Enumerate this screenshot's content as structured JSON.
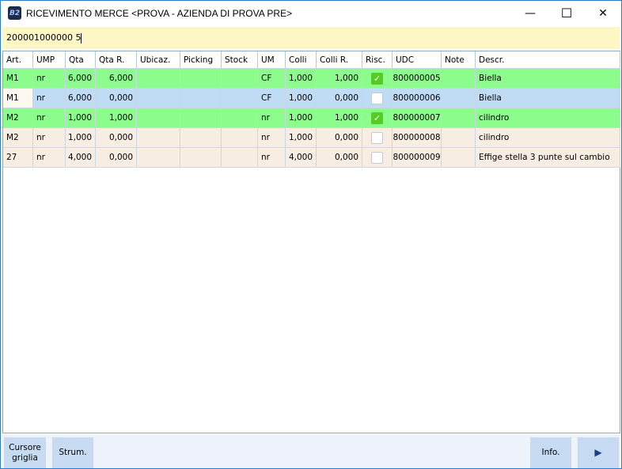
{
  "window": {
    "title": "RICEVIMENTO MERCE <PROVA - AZIENDA DI PROVA PRE>",
    "icon_text": "B2",
    "minimize": "—",
    "maximize": "☐",
    "close": "✕"
  },
  "barcode_input": {
    "value": "200001000000 5"
  },
  "colors": {
    "green": "#8cfc8c",
    "blue": "#c0dcf5",
    "beige": "#f7ede3"
  },
  "columns": [
    "Art.",
    "UMP",
    "Qta",
    "Qta R.",
    "Ubicaz.",
    "Picking",
    "Stock",
    "UM",
    "Colli",
    "Colli R.",
    "Risc.",
    "UDC",
    "Note",
    "Descr."
  ],
  "rows": [
    {
      "art": "M1",
      "ump": "nr",
      "qta": "6,000",
      "qtar": "6,000",
      "ubicaz": "",
      "picking": "",
      "stock": "",
      "um": "CF",
      "colli": "1,000",
      "collir": "1,000",
      "risc": true,
      "udc": "800000005",
      "note": "",
      "descr": "Biella",
      "color": "green"
    },
    {
      "art": "M1",
      "ump": "nr",
      "qta": "6,000",
      "qtar": "0,000",
      "ubicaz": "",
      "picking": "",
      "stock": "",
      "um": "CF",
      "colli": "1,000",
      "collir": "0,000",
      "risc": false,
      "udc": "800000006",
      "note": "",
      "descr": "Biella",
      "color": "blue"
    },
    {
      "art": "M2",
      "ump": "nr",
      "qta": "1,000",
      "qtar": "1,000",
      "ubicaz": "",
      "picking": "",
      "stock": "",
      "um": "nr",
      "colli": "1,000",
      "collir": "1,000",
      "risc": true,
      "udc": "800000007",
      "note": "",
      "descr": "cilindro",
      "color": "green"
    },
    {
      "art": "M2",
      "ump": "nr",
      "qta": "1,000",
      "qtar": "0,000",
      "ubicaz": "",
      "picking": "",
      "stock": "",
      "um": "nr",
      "colli": "1,000",
      "collir": "0,000",
      "risc": false,
      "udc": "800000008",
      "note": "",
      "descr": "cilindro",
      "color": "beige"
    },
    {
      "art": "27",
      "ump": "nr",
      "qta": "4,000",
      "qtar": "0,000",
      "ubicaz": "",
      "picking": "",
      "stock": "",
      "um": "nr",
      "colli": "4,000",
      "collir": "0,000",
      "risc": false,
      "udc": "800000009",
      "note": "",
      "descr": "Effige stella 3 punte sul cambio",
      "color": "beige"
    }
  ],
  "footer": {
    "cursor_label": "Cursore griglia",
    "tools_label": "Strum.",
    "info_label": "Info.",
    "next_icon": "▶"
  }
}
